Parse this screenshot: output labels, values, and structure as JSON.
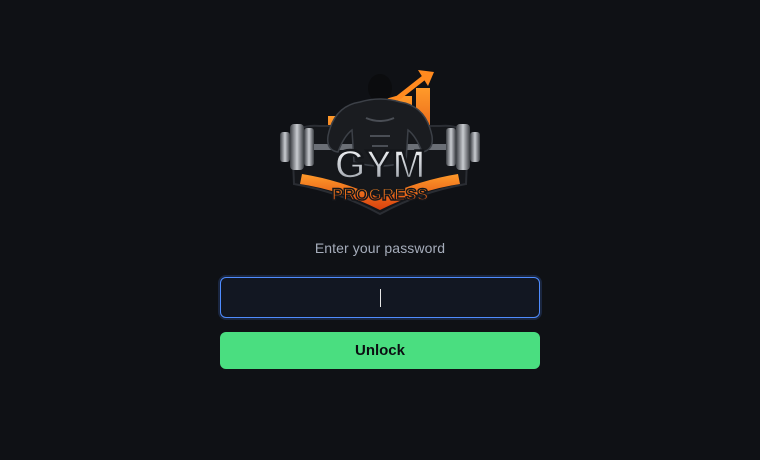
{
  "logo": {
    "line1": "GYM",
    "line2": "PROGRESS"
  },
  "login": {
    "prompt": "Enter your password",
    "password_value": "",
    "password_placeholder": "",
    "unlock_label": "Unlock"
  },
  "colors": {
    "background": "#0f1115",
    "field_background": "#121722",
    "field_border": "#4f8cff",
    "button": "#4ade80",
    "prompt_text": "#a6adbb",
    "logo_orange": "#f26a1b",
    "logo_silver": "#d7dbe0"
  }
}
